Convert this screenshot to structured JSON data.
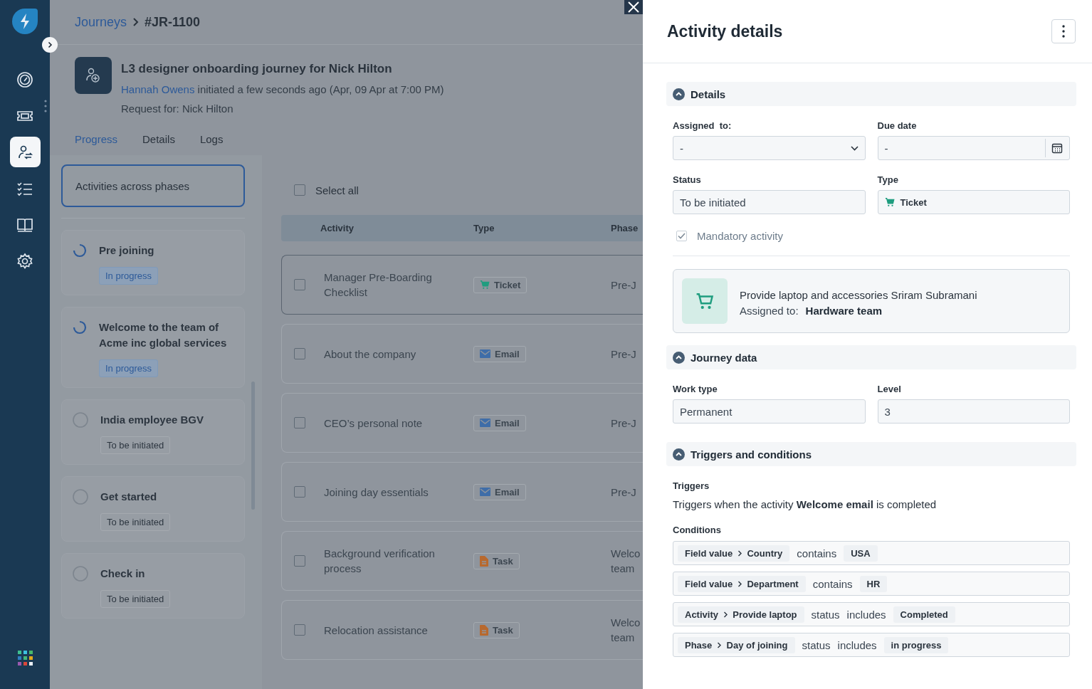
{
  "nav": {
    "items": [
      {
        "selected": false
      },
      {
        "selected": false
      },
      {
        "selected": true
      },
      {
        "selected": false
      },
      {
        "selected": false
      },
      {
        "selected": false
      }
    ]
  },
  "breadcrumb": {
    "parent": "Journeys",
    "current": "#JR-1100"
  },
  "journey": {
    "title": "L3 designer onboarding journey for Nick Hilton",
    "initiator": "Hannah Owens",
    "initiated": "initiated a few seconds ago (Apr, 09 Apr at 7:00 PM)",
    "request_for": "Request for: Nick Hilton"
  },
  "tabs": [
    {
      "label": "Progress",
      "selected": true
    },
    {
      "label": "Details",
      "selected": false
    },
    {
      "label": "Logs",
      "selected": false
    }
  ],
  "phases_header": "Activities across phases",
  "phases": [
    {
      "name": "Pre joining",
      "status": "In progress",
      "kind": "in_progress"
    },
    {
      "name": "Welcome to the team of Acme inc global services",
      "status": "In progress",
      "kind": "in_progress"
    },
    {
      "name": "India employee BGV",
      "status": "To be initiated",
      "kind": "to_be_initiated"
    },
    {
      "name": "Get started",
      "status": "To be initiated",
      "kind": "to_be_initiated"
    },
    {
      "name": "Check in",
      "status": "To be initiated",
      "kind": "to_be_initiated"
    }
  ],
  "select_all": {
    "label": "Select all",
    "checked": false
  },
  "table": {
    "columns": [
      "Activity",
      "Type",
      "Phase"
    ],
    "rows": [
      {
        "activity": "Manager Pre-Boarding Checklist",
        "type": "Ticket",
        "kind": "ticket",
        "phase": [
          "Pre-J"
        ],
        "selected": true,
        "checked": false
      },
      {
        "activity": "About the company",
        "type": "Email",
        "kind": "email",
        "phase": [
          "Pre-J"
        ],
        "selected": false,
        "checked": false
      },
      {
        "activity": "CEO’s personal note",
        "type": "Email",
        "kind": "email",
        "phase": [
          "Pre-J"
        ],
        "selected": false,
        "checked": false
      },
      {
        "activity": "Joining day essentials",
        "type": "Email",
        "kind": "email",
        "phase": [
          "Pre-J"
        ],
        "selected": false,
        "checked": false
      },
      {
        "activity": "Background verification process",
        "type": "Task",
        "kind": "task",
        "phase": [
          "Welco",
          "team"
        ],
        "selected": false,
        "checked": false
      },
      {
        "activity": "Relocation assistance",
        "type": "Task",
        "kind": "task",
        "phase": [
          "Welco",
          "team"
        ],
        "selected": false,
        "checked": false
      }
    ]
  },
  "drawer": {
    "title": "Activity details",
    "details": {
      "title": "Details",
      "expanded": true,
      "assigned_to": {
        "label": "Assigned  to:",
        "value": "-"
      },
      "due_date": {
        "label": "Due date",
        "value": "-"
      },
      "status": {
        "label": "Status",
        "value": "To be initiated"
      },
      "type": {
        "label": "Type",
        "value": "Ticket",
        "kind": "ticket"
      },
      "mandatory": {
        "label": "Mandatory activity",
        "checked": true
      },
      "linked": {
        "title": "Provide laptop and accessories Sriram Subramani",
        "assigned_label": "Assigned to:",
        "assigned_value": "Hardware team"
      }
    },
    "journey_data": {
      "title": "Journey data",
      "expanded": true,
      "fields": [
        {
          "label": "Work type",
          "value": "Permanent"
        },
        {
          "label": "Level",
          "value": "3"
        }
      ]
    },
    "triggers": {
      "title": "Triggers and conditions",
      "expanded": true,
      "triggers_label": "Triggers",
      "trigger_text": "Triggers when the activity **Welcome email** is completed",
      "conditions_label": "Conditions",
      "conditions": [
        {
          "source": "Field value",
          "target": "Country",
          "operators": [
            "contains"
          ],
          "value": "USA"
        },
        {
          "source": "Field value",
          "target": "Department",
          "operators": [
            "contains"
          ],
          "value": "HR"
        },
        {
          "source": "Activity",
          "target": "Provide laptop",
          "operators": [
            "status",
            "includes"
          ],
          "value": "Completed"
        },
        {
          "source": "Phase",
          "target": "Day of joining",
          "operators": [
            "status",
            "includes"
          ],
          "value": "in progress"
        }
      ]
    }
  }
}
